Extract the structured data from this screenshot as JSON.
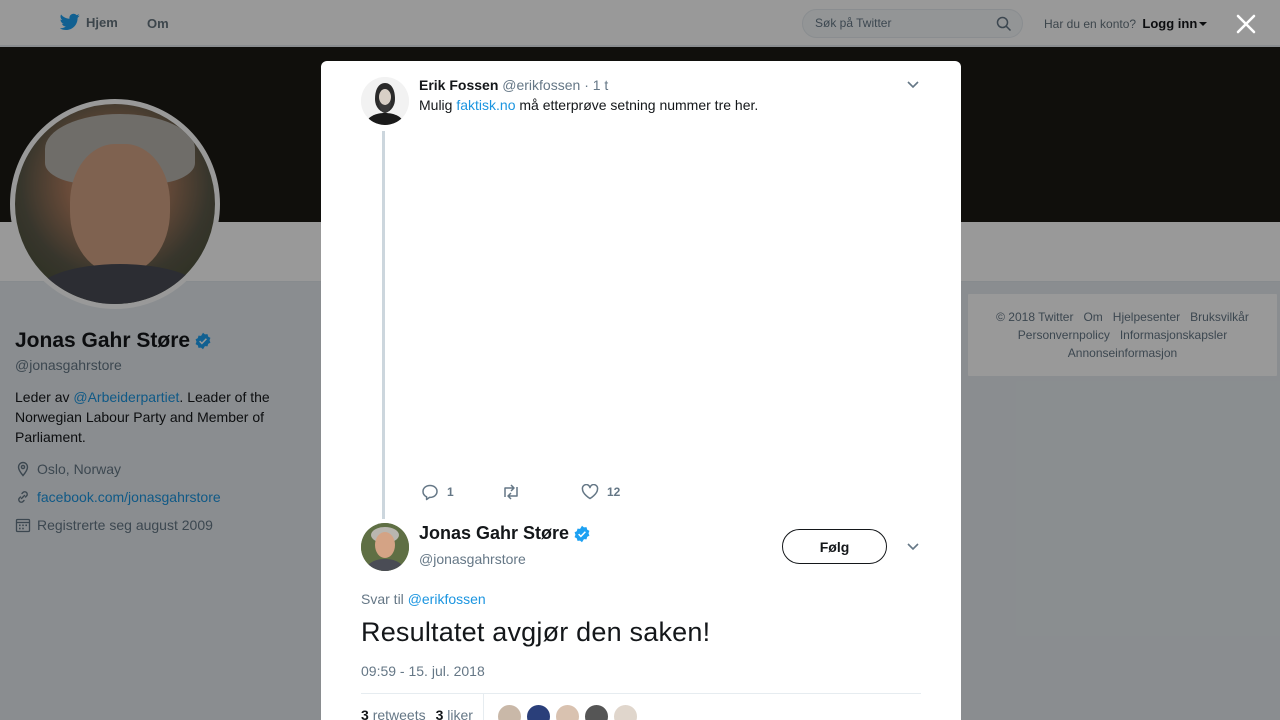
{
  "nav": {
    "home_label": "Hjem",
    "about_label": "Om",
    "search_placeholder": "Søk på Twitter",
    "account_question": "Har du en konto?",
    "login_label": "Logg inn"
  },
  "profile": {
    "name": "Jonas Gahr Støre",
    "handle": "@jonasgahrstore",
    "bio_prefix": "Leder av ",
    "bio_mention": "@Arbeiderpartiet",
    "bio_suffix": ". Leader of the Norwegian Labour Party and Member of Parliament.",
    "location": "Oslo, Norway",
    "website": "facebook.com/jonasgahrstore",
    "joined": "Registrerte seg august 2009"
  },
  "footer": {
    "links": [
      "© 2018 Twitter",
      "Om",
      "Hjelpesenter",
      "Bruksvilkår",
      "Personvernpolicy",
      "Informasjonskapsler",
      "Annonseinformasjon"
    ]
  },
  "parent_tweet": {
    "name": "Erik Fossen",
    "handle": "@erikfossen",
    "time": "· 1 t",
    "text_prefix": "Mulig ",
    "text_link": "faktisk.no",
    "text_suffix": " må etterprøve setning nummer tre her.",
    "reply_count": "1",
    "retweet_count": "",
    "like_count": "12"
  },
  "main_tweet": {
    "name": "Jonas Gahr Støre",
    "handle": "@jonasgahrstore",
    "follow_label": "Følg",
    "reply_prefix": "Svar til ",
    "reply_to": "@erikfossen",
    "text": "Resultatet avgjør den saken!",
    "timestamp": "09:59 - 15. jul. 2018",
    "retweets_count": "3",
    "retweets_label": "retweets",
    "likes_count": "3",
    "likes_label": "liker"
  },
  "colors": {
    "accent": "#1b95e0",
    "verified": "#1da1f2",
    "header_photo": "#1b1915"
  }
}
